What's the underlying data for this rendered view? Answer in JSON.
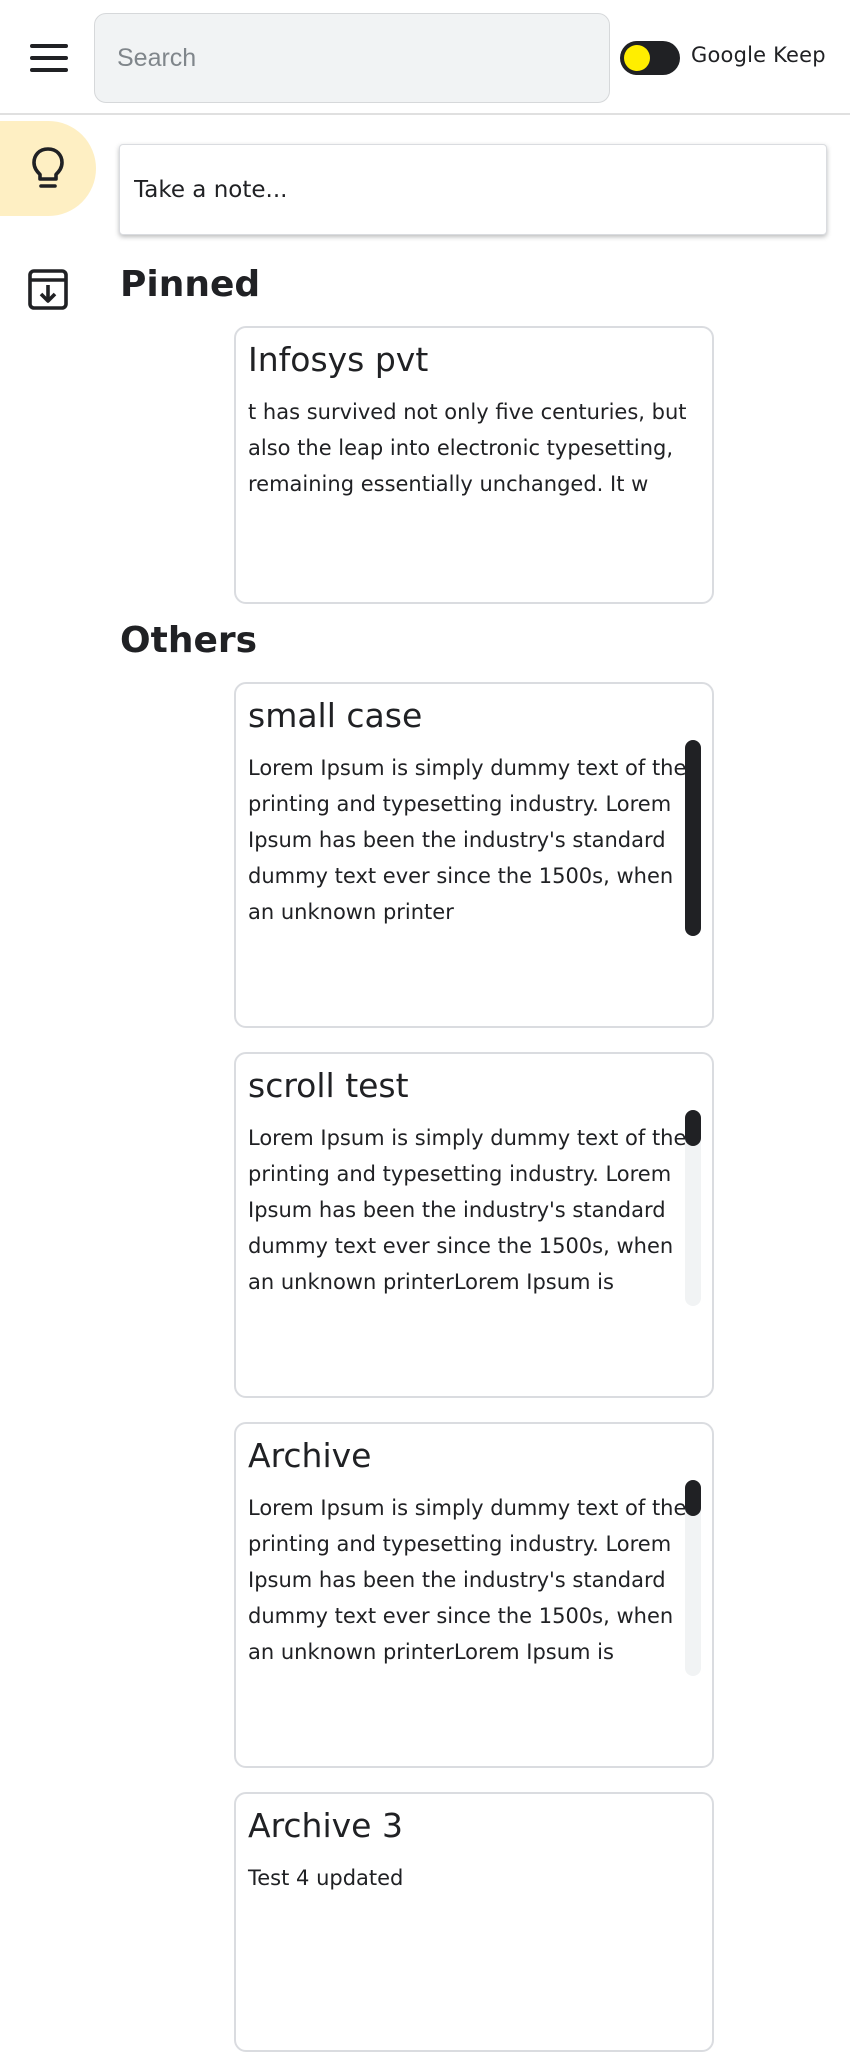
{
  "header": {
    "search_placeholder": "Search",
    "app_title": "Google Keep",
    "toggle_colors": {
      "track": "#202124",
      "knob": "#ffee00"
    }
  },
  "sidebar": {
    "items": [
      {
        "icon": "lightbulb-icon",
        "active": true,
        "active_color": "#feefc3"
      },
      {
        "icon": "archive-icon",
        "active": false
      }
    ]
  },
  "main": {
    "take_note_placeholder": "Take a note...",
    "sections": [
      {
        "title": "Pinned",
        "notes": [
          {
            "title": "Infosys pvt",
            "body": "t has survived not only five centuries, but also the leap into electronic typesetting, remaining essentially unchanged. It w",
            "scrollbar": false
          }
        ]
      },
      {
        "title": "Others",
        "notes": [
          {
            "title": "small case",
            "body": "Lorem Ipsum is simply dummy text of the printing and typesetting industry. Lorem Ipsum has been the industry's standard dummy text ever since the 1500s, when an unknown printer",
            "scrollbar": true
          },
          {
            "title": "scroll test",
            "body": "Lorem Ipsum is simply dummy text of the printing and typesetting industry. Lorem Ipsum has been the industry's standard dummy text ever since the 1500s, when an unknown printerLorem Ipsum is",
            "scrollbar": true
          },
          {
            "title": "Archive",
            "body": "Lorem Ipsum is simply dummy text of the printing and typesetting industry. Lorem Ipsum has been the industry's standard dummy text ever since the 1500s, when an unknown printerLorem Ipsum is",
            "scrollbar": true
          },
          {
            "title": "Archive 3",
            "body": "Test 4 updated",
            "scrollbar": false
          }
        ]
      }
    ]
  }
}
